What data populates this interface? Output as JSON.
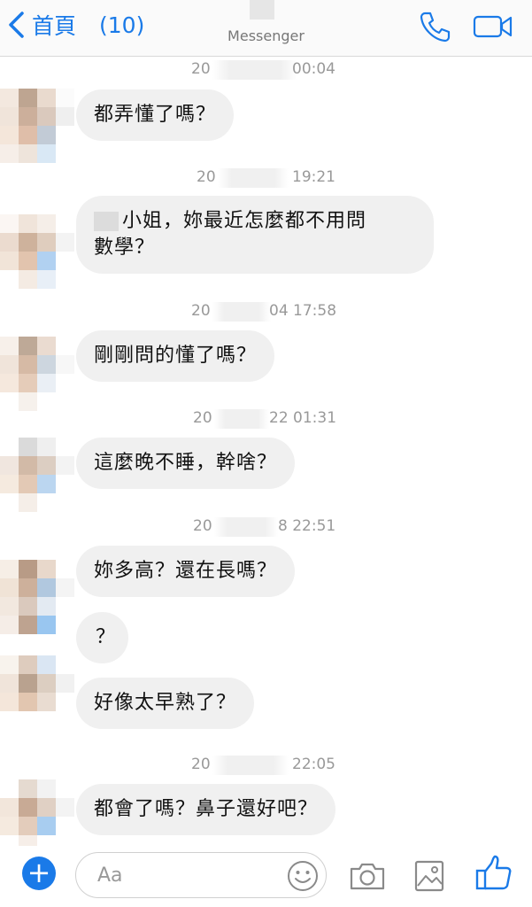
{
  "header": {
    "back_label": "首頁",
    "unread_count": "(10)",
    "subtitle": "Messenger",
    "icons": {
      "back": "chevron-left-icon",
      "phone": "phone-icon",
      "video": "video-camera-icon"
    },
    "accent_color": "#1a7ae8"
  },
  "timestamps": [
    {
      "left": "20",
      "right": "00:04"
    },
    {
      "left": "20",
      "right": "19:21"
    },
    {
      "left": "20",
      "right": "04 17:58"
    },
    {
      "left": "20",
      "right": "22 01:31"
    },
    {
      "left": "20",
      "right": "8 22:51"
    },
    {
      "left": "20",
      "right": "22:05"
    }
  ],
  "messages": [
    {
      "text": "都弄懂了嗎？"
    },
    {
      "line1": "小姐，妳最近怎麼都不用問",
      "line2": "數學？"
    },
    {
      "text": "剛剛問的懂了嗎？"
    },
    {
      "text": "這麼晚不睡，幹啥？"
    },
    {
      "text": "妳多高？還在長嗎？"
    },
    {
      "text": "？"
    },
    {
      "text": "好像太早熟了？"
    },
    {
      "text": "都會了嗎？鼻子還好吧？"
    }
  ],
  "composer": {
    "placeholder": "Aa",
    "icons": {
      "add": "plus-icon",
      "emoji": "smiley-icon",
      "camera": "camera-icon",
      "gallery": "image-icon",
      "like": "thumbs-up-icon"
    }
  }
}
